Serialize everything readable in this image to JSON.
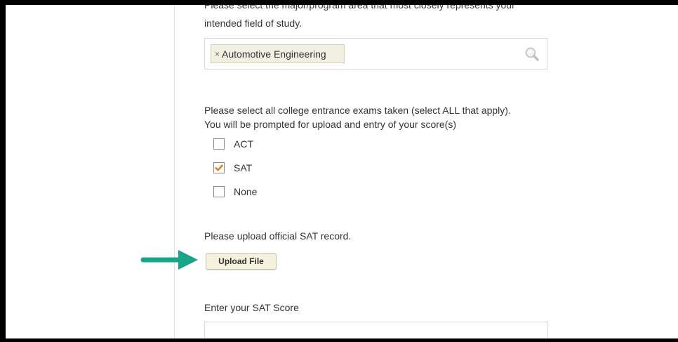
{
  "major": {
    "prompt_line1": "Please select the major/program area that most closely represents your",
    "prompt_line2": "intended field of study.",
    "selected_tag": "Automotive Engineering",
    "remove_glyph": "×"
  },
  "exams": {
    "prompt_line1": "Please select all college entrance exams taken (select ALL that apply).",
    "prompt_line2": "You will be prompted for upload and entry of your score(s)",
    "options": [
      {
        "label": "ACT",
        "checked": false
      },
      {
        "label": "SAT",
        "checked": true
      },
      {
        "label": "None",
        "checked": false
      }
    ]
  },
  "upload": {
    "prompt": "Please upload official SAT record.",
    "button_label": "Upload File"
  },
  "score": {
    "label": "Enter your SAT Score",
    "value": "",
    "placeholder": ""
  },
  "colors": {
    "check_mark": "#d9781f",
    "arrow": "#19a58a",
    "tag_bg": "#f1efe2",
    "button_bg": "#f4f1de"
  }
}
